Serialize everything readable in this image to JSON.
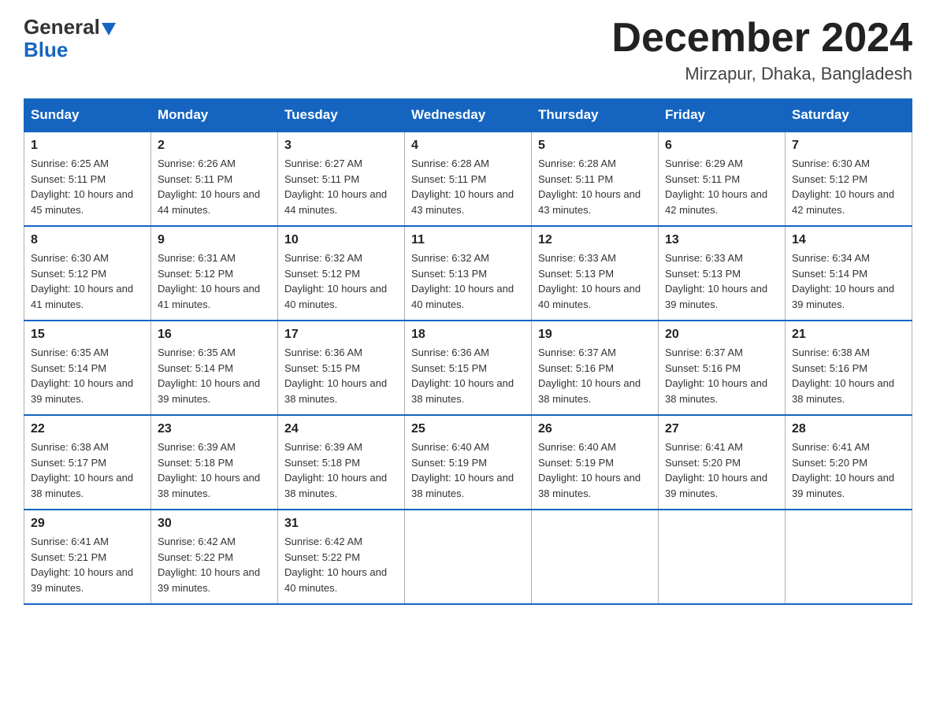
{
  "header": {
    "logo_general": "General",
    "logo_blue": "Blue",
    "month_title": "December 2024",
    "location": "Mirzapur, Dhaka, Bangladesh"
  },
  "weekdays": [
    "Sunday",
    "Monday",
    "Tuesday",
    "Wednesday",
    "Thursday",
    "Friday",
    "Saturday"
  ],
  "weeks": [
    [
      {
        "day": "1",
        "sunrise": "6:25 AM",
        "sunset": "5:11 PM",
        "daylight": "10 hours and 45 minutes."
      },
      {
        "day": "2",
        "sunrise": "6:26 AM",
        "sunset": "5:11 PM",
        "daylight": "10 hours and 44 minutes."
      },
      {
        "day": "3",
        "sunrise": "6:27 AM",
        "sunset": "5:11 PM",
        "daylight": "10 hours and 44 minutes."
      },
      {
        "day": "4",
        "sunrise": "6:28 AM",
        "sunset": "5:11 PM",
        "daylight": "10 hours and 43 minutes."
      },
      {
        "day": "5",
        "sunrise": "6:28 AM",
        "sunset": "5:11 PM",
        "daylight": "10 hours and 43 minutes."
      },
      {
        "day": "6",
        "sunrise": "6:29 AM",
        "sunset": "5:11 PM",
        "daylight": "10 hours and 42 minutes."
      },
      {
        "day": "7",
        "sunrise": "6:30 AM",
        "sunset": "5:12 PM",
        "daylight": "10 hours and 42 minutes."
      }
    ],
    [
      {
        "day": "8",
        "sunrise": "6:30 AM",
        "sunset": "5:12 PM",
        "daylight": "10 hours and 41 minutes."
      },
      {
        "day": "9",
        "sunrise": "6:31 AM",
        "sunset": "5:12 PM",
        "daylight": "10 hours and 41 minutes."
      },
      {
        "day": "10",
        "sunrise": "6:32 AM",
        "sunset": "5:12 PM",
        "daylight": "10 hours and 40 minutes."
      },
      {
        "day": "11",
        "sunrise": "6:32 AM",
        "sunset": "5:13 PM",
        "daylight": "10 hours and 40 minutes."
      },
      {
        "day": "12",
        "sunrise": "6:33 AM",
        "sunset": "5:13 PM",
        "daylight": "10 hours and 40 minutes."
      },
      {
        "day": "13",
        "sunrise": "6:33 AM",
        "sunset": "5:13 PM",
        "daylight": "10 hours and 39 minutes."
      },
      {
        "day": "14",
        "sunrise": "6:34 AM",
        "sunset": "5:14 PM",
        "daylight": "10 hours and 39 minutes."
      }
    ],
    [
      {
        "day": "15",
        "sunrise": "6:35 AM",
        "sunset": "5:14 PM",
        "daylight": "10 hours and 39 minutes."
      },
      {
        "day": "16",
        "sunrise": "6:35 AM",
        "sunset": "5:14 PM",
        "daylight": "10 hours and 39 minutes."
      },
      {
        "day": "17",
        "sunrise": "6:36 AM",
        "sunset": "5:15 PM",
        "daylight": "10 hours and 38 minutes."
      },
      {
        "day": "18",
        "sunrise": "6:36 AM",
        "sunset": "5:15 PM",
        "daylight": "10 hours and 38 minutes."
      },
      {
        "day": "19",
        "sunrise": "6:37 AM",
        "sunset": "5:16 PM",
        "daylight": "10 hours and 38 minutes."
      },
      {
        "day": "20",
        "sunrise": "6:37 AM",
        "sunset": "5:16 PM",
        "daylight": "10 hours and 38 minutes."
      },
      {
        "day": "21",
        "sunrise": "6:38 AM",
        "sunset": "5:16 PM",
        "daylight": "10 hours and 38 minutes."
      }
    ],
    [
      {
        "day": "22",
        "sunrise": "6:38 AM",
        "sunset": "5:17 PM",
        "daylight": "10 hours and 38 minutes."
      },
      {
        "day": "23",
        "sunrise": "6:39 AM",
        "sunset": "5:18 PM",
        "daylight": "10 hours and 38 minutes."
      },
      {
        "day": "24",
        "sunrise": "6:39 AM",
        "sunset": "5:18 PM",
        "daylight": "10 hours and 38 minutes."
      },
      {
        "day": "25",
        "sunrise": "6:40 AM",
        "sunset": "5:19 PM",
        "daylight": "10 hours and 38 minutes."
      },
      {
        "day": "26",
        "sunrise": "6:40 AM",
        "sunset": "5:19 PM",
        "daylight": "10 hours and 38 minutes."
      },
      {
        "day": "27",
        "sunrise": "6:41 AM",
        "sunset": "5:20 PM",
        "daylight": "10 hours and 39 minutes."
      },
      {
        "day": "28",
        "sunrise": "6:41 AM",
        "sunset": "5:20 PM",
        "daylight": "10 hours and 39 minutes."
      }
    ],
    [
      {
        "day": "29",
        "sunrise": "6:41 AM",
        "sunset": "5:21 PM",
        "daylight": "10 hours and 39 minutes."
      },
      {
        "day": "30",
        "sunrise": "6:42 AM",
        "sunset": "5:22 PM",
        "daylight": "10 hours and 39 minutes."
      },
      {
        "day": "31",
        "sunrise": "6:42 AM",
        "sunset": "5:22 PM",
        "daylight": "10 hours and 40 minutes."
      },
      null,
      null,
      null,
      null
    ]
  ]
}
